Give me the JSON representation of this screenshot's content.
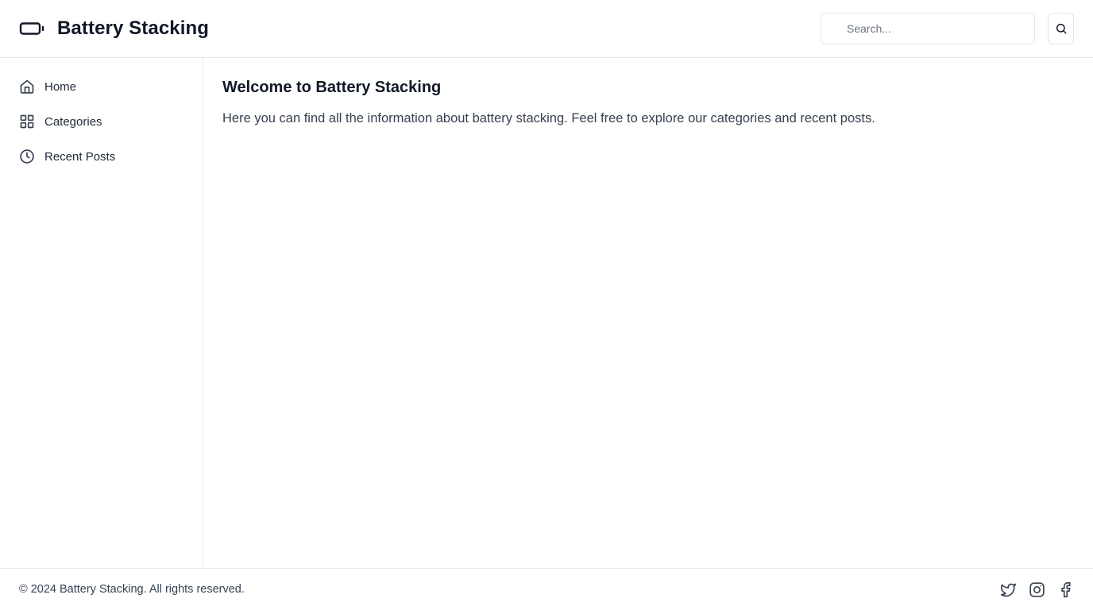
{
  "header": {
    "brand_icon": "battery-icon",
    "title": "Battery Stacking",
    "search": {
      "placeholder": "Search...",
      "value": ""
    },
    "search_button_icon": "search-icon"
  },
  "sidebar": {
    "items": [
      {
        "label": "Home",
        "icon": "home-icon"
      },
      {
        "label": "Categories",
        "icon": "grid-icon"
      },
      {
        "label": "Recent Posts",
        "icon": "clock-icon"
      }
    ]
  },
  "main": {
    "title": "Welcome to Battery Stacking",
    "text": "Here you can find all the information about battery stacking. Feel free to explore our categories and recent posts."
  },
  "footer": {
    "copyright": "© 2024 Battery Stacking. All rights reserved.",
    "socials": [
      "twitter-icon",
      "instagram-icon",
      "facebook-icon"
    ]
  },
  "colors": {
    "text": "#111827",
    "muted": "#374151",
    "border": "#e5e7eb"
  }
}
